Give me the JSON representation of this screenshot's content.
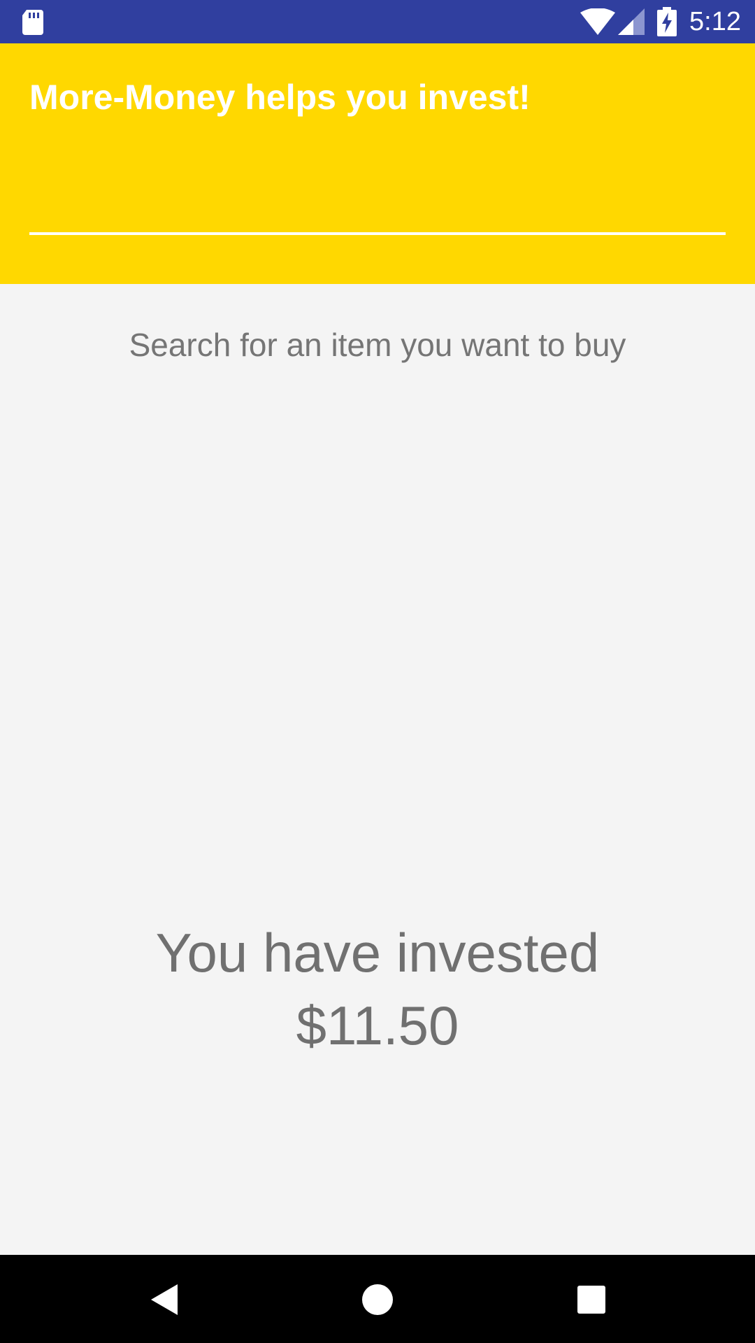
{
  "status_bar": {
    "time": "5:12",
    "background_color": "#303f9f",
    "icons": [
      "sd-card-icon",
      "wifi-icon",
      "signal-icon",
      "battery-charging-icon"
    ]
  },
  "header": {
    "title": "More-Money helps you invest!",
    "search_value": "",
    "background_color": "#ffd800"
  },
  "main": {
    "hint": "Search for an item you want to buy",
    "invested_label": "You have invested",
    "invested_amount": "$11.50"
  },
  "nav_bar": {
    "icons": [
      "back-icon",
      "home-icon",
      "recents-icon"
    ]
  }
}
